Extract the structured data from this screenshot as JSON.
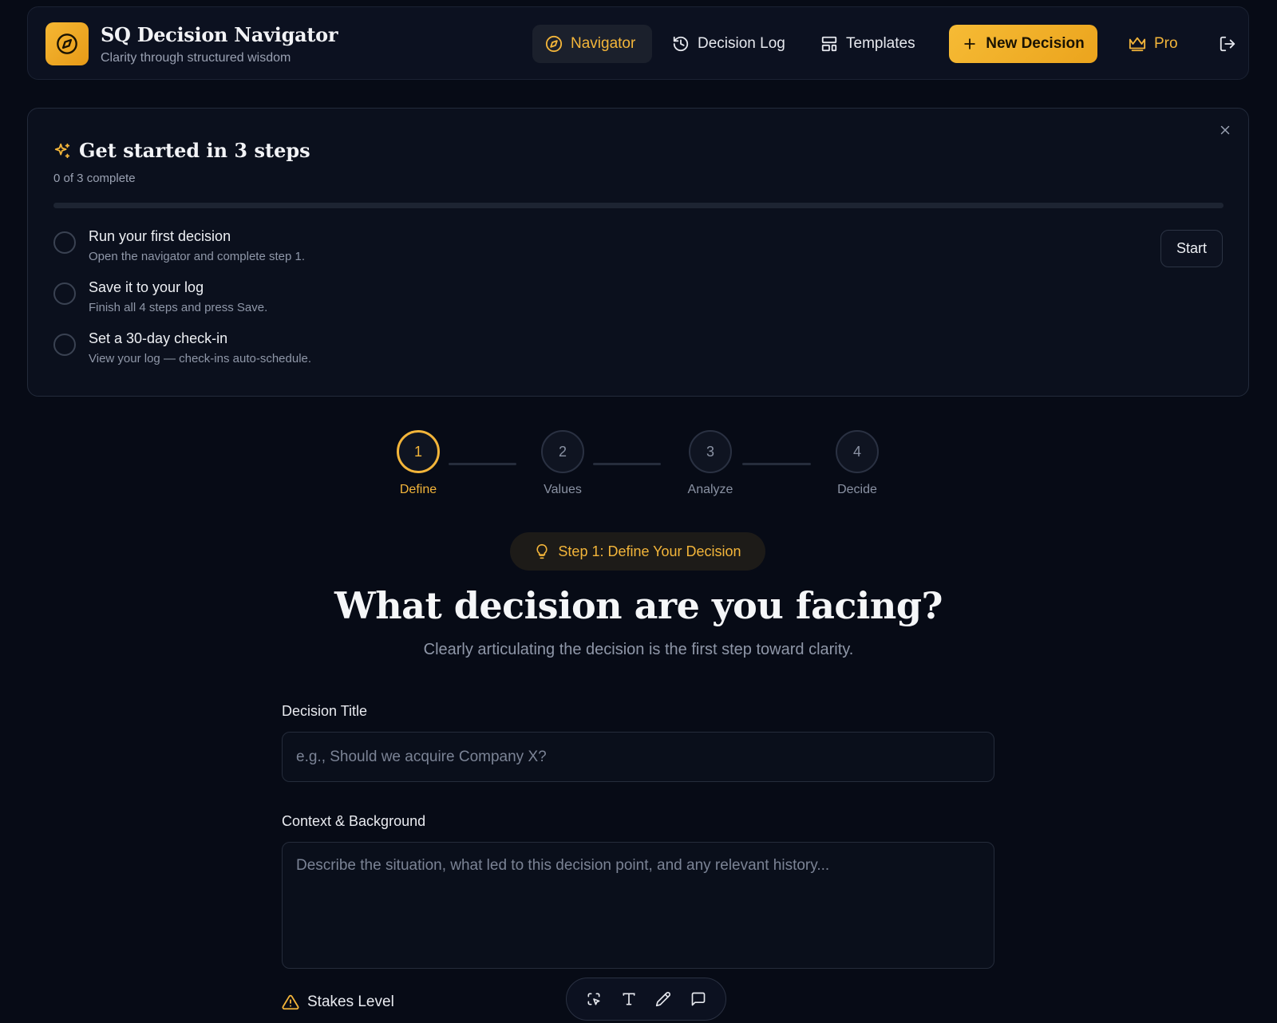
{
  "brand": {
    "title": "SQ Decision Navigator",
    "subtitle": "Clarity through structured wisdom"
  },
  "nav": {
    "navigator": "Navigator",
    "decision_log": "Decision Log",
    "templates": "Templates",
    "new_decision": "New Decision",
    "pro": "Pro"
  },
  "onboarding": {
    "title": "Get started in 3 steps",
    "count": "0 of 3 complete",
    "progress": 0,
    "start_label": "Start",
    "steps": [
      {
        "title": "Run your first decision",
        "desc": "Open the navigator and complete step 1."
      },
      {
        "title": "Save it to your log",
        "desc": "Finish all 4 steps and press Save."
      },
      {
        "title": "Set a 30-day check-in",
        "desc": "View your log — check-ins auto-schedule."
      }
    ]
  },
  "stepper": [
    {
      "number": "1",
      "label": "Define"
    },
    {
      "number": "2",
      "label": "Values"
    },
    {
      "number": "3",
      "label": "Analyze"
    },
    {
      "number": "4",
      "label": "Decide"
    }
  ],
  "step_badge": "Step 1: Define Your Decision",
  "main": {
    "title": "What decision are you facing?",
    "subtitle": "Clearly articulating the decision is the first step toward clarity."
  },
  "form": {
    "title_label": "Decision Title",
    "title_placeholder": "e.g., Should we acquire Company X?",
    "context_label": "Context & Background",
    "context_placeholder": "Describe the situation, what led to this decision point, and any relevant history...",
    "stakes_label": "Stakes Level"
  },
  "colors": {
    "accent": "#f3b53a",
    "background": "#070b16",
    "panel": "#0c1120"
  }
}
